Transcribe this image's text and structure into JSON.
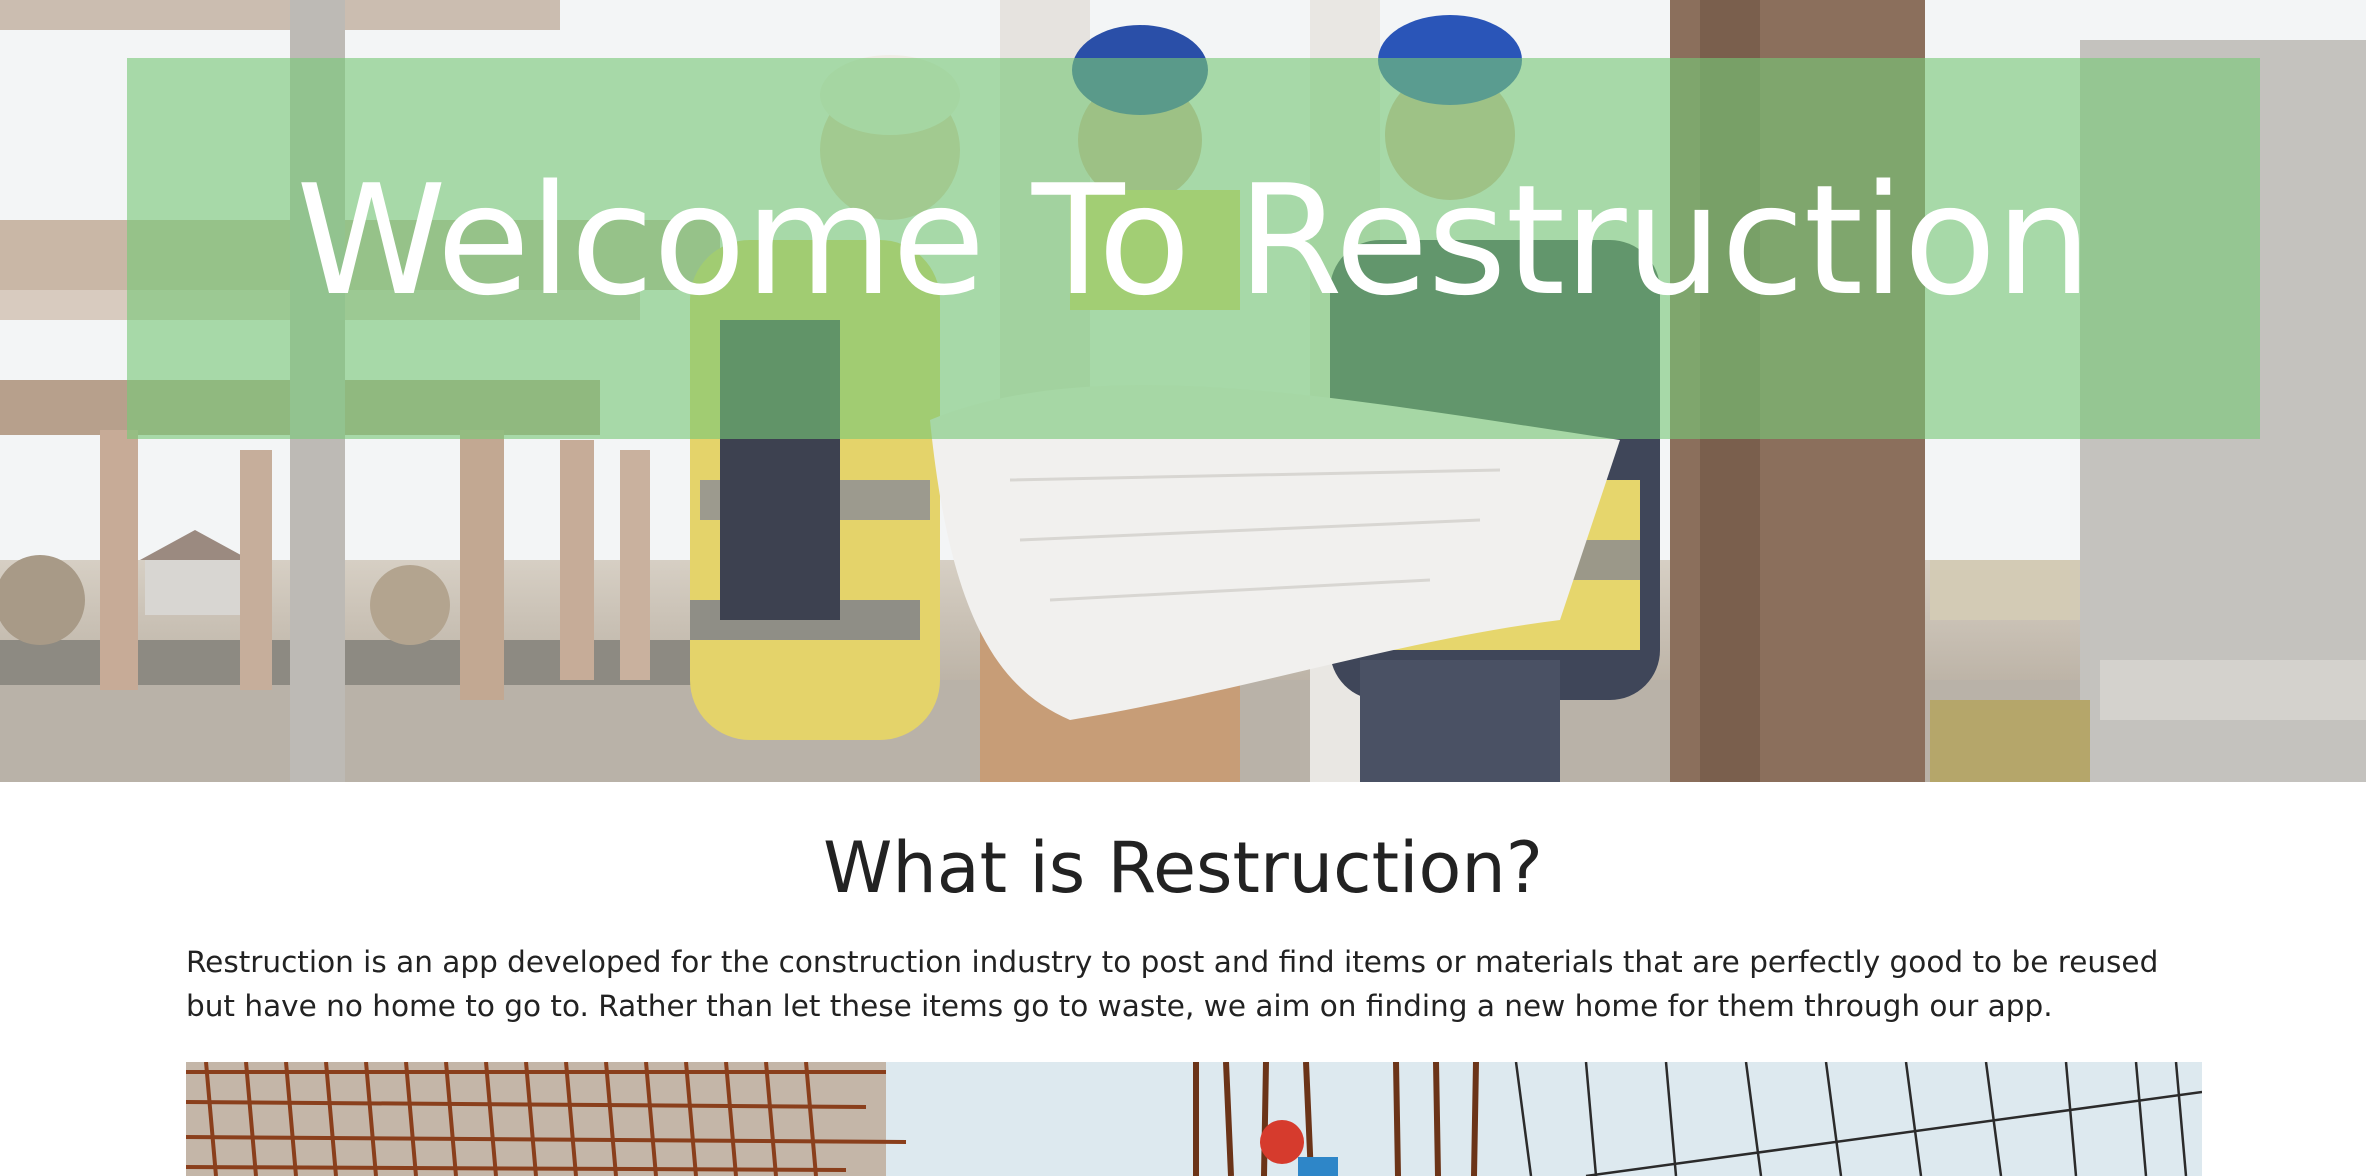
{
  "hero": {
    "title": "Welcome To Restruction",
    "band_color": "#78c878"
  },
  "about": {
    "heading": "What is Restruction?",
    "description": "Restruction is an app developed for the construction industry to post and find items or materials that are perfectly good to be reused but have no home to go to. Rather than let these items go to waste, we aim on finding a new home for them through our app."
  },
  "images": {
    "hero_photo": "engineers-reviewing-blueprint-photo",
    "about_photo": "construction-rebar-site-photo"
  }
}
